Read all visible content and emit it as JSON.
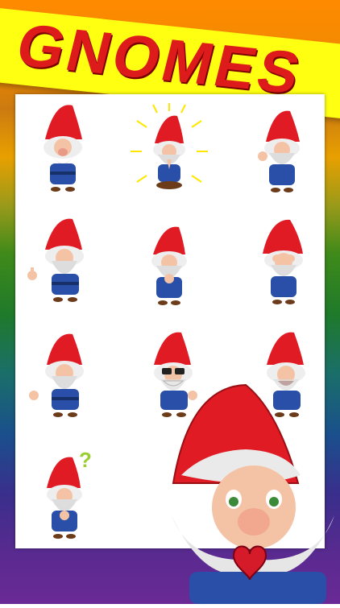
{
  "header": {
    "title": "GNOMES"
  },
  "stickers": [
    {
      "pose": "eyes-closed"
    },
    {
      "pose": "praying-glowing"
    },
    {
      "pose": "waving"
    },
    {
      "pose": "thumbs-up"
    },
    {
      "pose": "hands-clasped"
    },
    {
      "pose": "covering-eyes"
    },
    {
      "pose": "pointing"
    },
    {
      "pose": "sunglasses-grin"
    },
    {
      "pose": "laughing"
    },
    {
      "pose": "confused"
    }
  ],
  "question_mark": "?",
  "colors": {
    "hat": "#e01b24",
    "coat": "#2a4fa8",
    "banner": "#ffff11",
    "title": "#dd1b1b"
  },
  "featured": {
    "pose": "holding-heart"
  }
}
